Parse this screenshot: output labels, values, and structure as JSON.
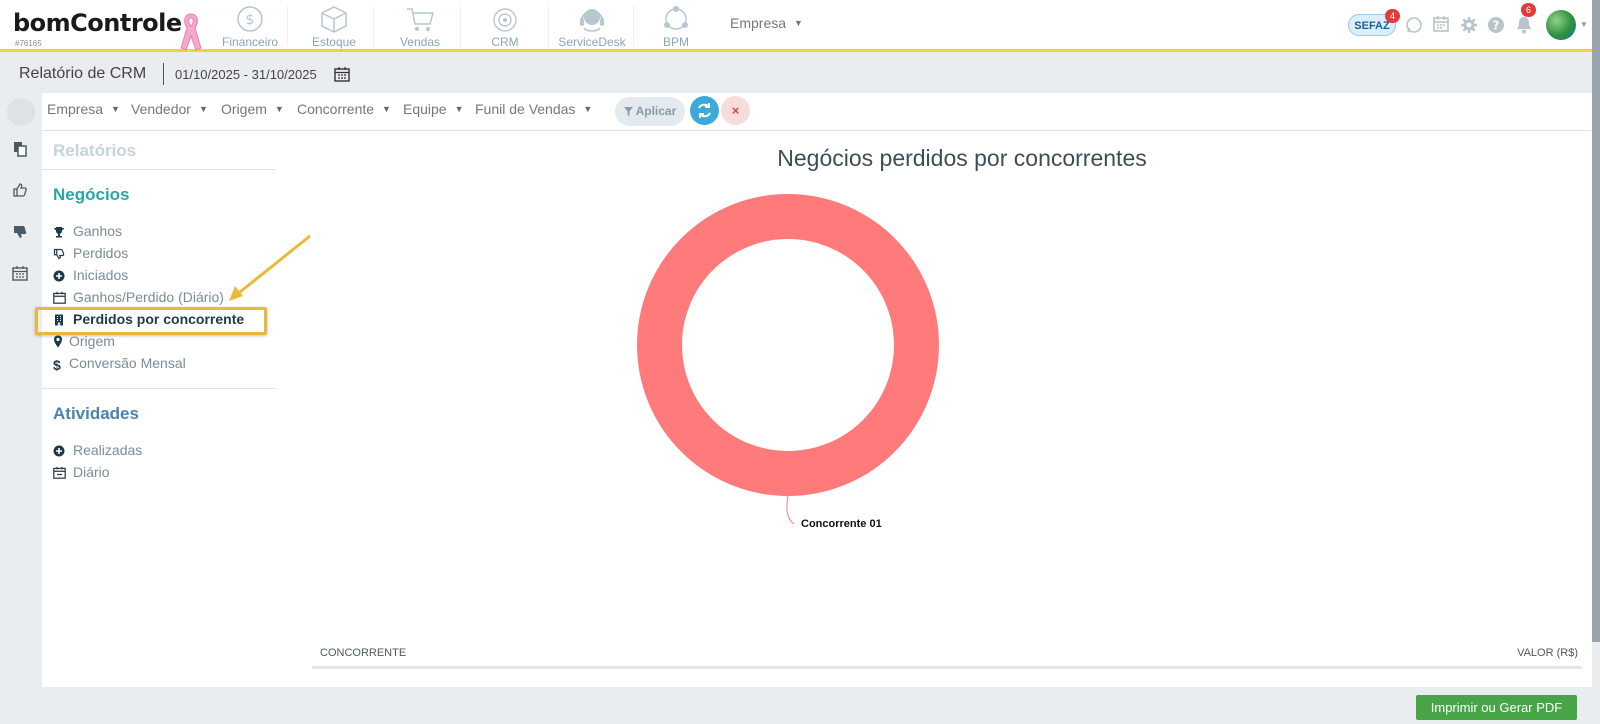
{
  "brand": {
    "name": "bomControle",
    "code": "#76165"
  },
  "modules": [
    {
      "label": "Financeiro",
      "icon": "dollar-circle-icon"
    },
    {
      "label": "Estoque",
      "icon": "box-icon"
    },
    {
      "label": "Vendas",
      "icon": "cart-icon"
    },
    {
      "label": "CRM",
      "icon": "target-icon"
    },
    {
      "label": "ServiceDesk",
      "icon": "headset-icon"
    },
    {
      "label": "BPM",
      "icon": "network-icon"
    }
  ],
  "top": {
    "empresa_label": "Empresa",
    "sefaz_label": "SEFAZ",
    "sefaz_badge": "4",
    "notif_badge": "6"
  },
  "subheader": {
    "title": "Relatório de CRM",
    "date_range": "01/10/2025 - 31/10/2025"
  },
  "filters": [
    {
      "label": "Empresa"
    },
    {
      "label": "Vendedor"
    },
    {
      "label": "Origem"
    },
    {
      "label": "Concorrente"
    },
    {
      "label": "Equipe"
    },
    {
      "label": "Funil de Vendas"
    }
  ],
  "buttons": {
    "apply": "Aplicar",
    "clear": "×",
    "print": "Imprimir ou Gerar PDF"
  },
  "menu": {
    "reports_title": "Relatórios",
    "negocios_title": "Negócios",
    "negocios_items": [
      {
        "label": "Ganhos",
        "icon": "trophy-icon"
      },
      {
        "label": "Perdidos",
        "icon": "thumbs-down-icon"
      },
      {
        "label": "Iniciados",
        "icon": "plus-circle-icon"
      },
      {
        "label": "Ganhos/Perdido (Diário)",
        "icon": "calendar-icon"
      },
      {
        "label": "Perdidos por concorrente",
        "icon": "building-icon",
        "active": true
      },
      {
        "label": "Origem",
        "icon": "map-marker-icon"
      },
      {
        "label": "Conversão Mensal",
        "icon": "dollar-icon"
      }
    ],
    "atividades_title": "Atividades",
    "atividades_items": [
      {
        "label": "Realizadas",
        "icon": "plus-circle-icon"
      },
      {
        "label": "Diário",
        "icon": "calendar-minus-icon"
      }
    ]
  },
  "chart_data": {
    "type": "pie",
    "title": "Negócios perdidos por concorrentes",
    "categories": [
      "Concorrente 01"
    ],
    "values": [
      100
    ],
    "colors": [
      "#ff7b7b"
    ],
    "donut": true
  },
  "table": {
    "col_concorrente": "CONCORRENTE",
    "col_valor": "VALOR (R$)"
  },
  "colors": {
    "accent_yellow": "#f2d43a",
    "teal_section": "#2aa6a6",
    "blue_section": "#4a83b0",
    "print_green": "#47a447"
  }
}
